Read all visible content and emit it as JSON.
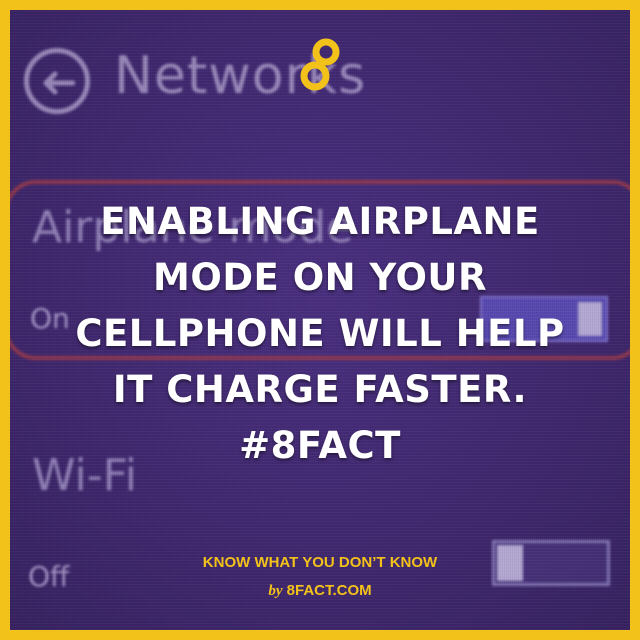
{
  "background_ui": {
    "title": "Networks",
    "airplane_label": "Airplane mode",
    "airplane_state": "On",
    "wifi_label": "Wi-Fi",
    "wifi_state": "Off"
  },
  "headline": {
    "lines": [
      "ENABLING AIRPLANE",
      "MODE ON YOUR",
      "CELLPHONE WILL HELP",
      "IT CHARGE FASTER.",
      "#8FACT"
    ]
  },
  "footer": {
    "tagline": "KNOW WHAT YOU DON’T KNOW",
    "by": "by",
    "site": "8FACT.COM"
  },
  "colors": {
    "frame": "#f3c21a",
    "background": "#4a2f80",
    "text": "#ffffff",
    "accent": "#f3c21a"
  },
  "icons": {
    "logo": "8fact-logo",
    "back": "back-arrow-icon"
  }
}
